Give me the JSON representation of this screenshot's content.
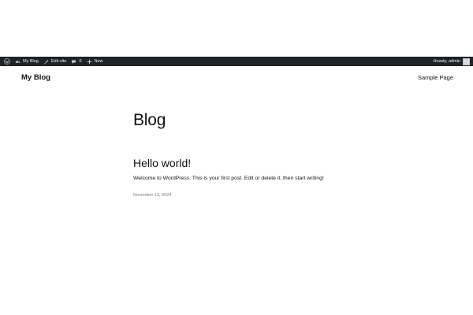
{
  "admin_bar": {
    "icons": {
      "wp_logo": "wordpress-logo-icon",
      "site": "dashboard-icon",
      "edit": "brush-icon",
      "comments": "comment-bubble-icon",
      "new": "plus-icon"
    },
    "site_name": "My Blog",
    "edit_site_label": "Edit site",
    "comments_count": "0",
    "new_label": "New",
    "greeting": "Howdy, admin"
  },
  "header": {
    "site_title": "My Blog",
    "nav": [
      "Sample Page"
    ]
  },
  "main": {
    "heading": "Blog",
    "posts": [
      {
        "title": "Hello world!",
        "excerpt": "Welcome to WordPress. This is your first post. Edit or delete it, then start writing!",
        "date": "November 13, 2024"
      }
    ]
  },
  "colors": {
    "admin_bar_bg": "#1d2327",
    "admin_bar_text": "#f0f0f1",
    "text": "#111111",
    "date_text": "#7a7a7a"
  }
}
